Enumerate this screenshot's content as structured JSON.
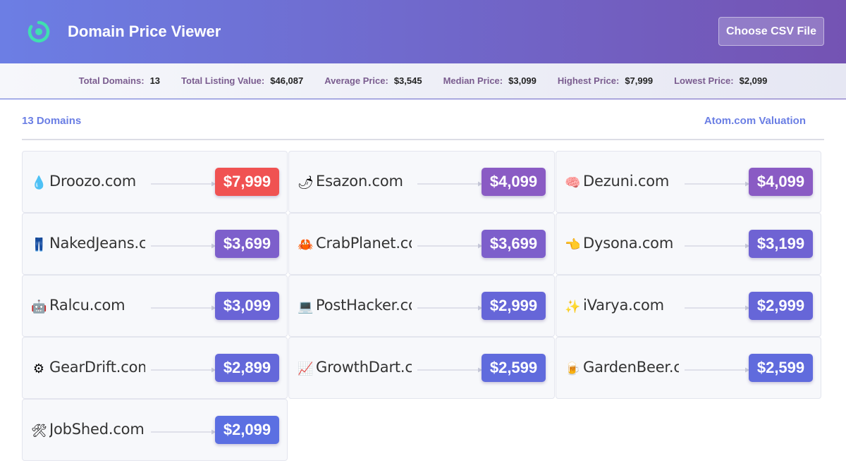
{
  "header": {
    "title": "Domain Price Viewer",
    "logo_icon": "ring-logo-icon",
    "csv_button_label": "Choose CSV File"
  },
  "stats": [
    {
      "label": "Total Domains:",
      "value": "13"
    },
    {
      "label": "Total Listing Value:",
      "value": "$46,087"
    },
    {
      "label": "Average Price:",
      "value": "$3,545"
    },
    {
      "label": "Median Price:",
      "value": "$3,099"
    },
    {
      "label": "Highest Price:",
      "value": "$7,999"
    },
    {
      "label": "Lowest Price:",
      "value": "$2,099"
    }
  ],
  "list": {
    "count_label": "13 Domains",
    "valuation_label": "Atom.com Valuation"
  },
  "domains": [
    {
      "icon": "💧",
      "icon_name": "droplet-icon",
      "name": "Droozo.com",
      "price": "$7,999",
      "color": "#f05252"
    },
    {
      "icon": "🌶",
      "icon_name": "chili-pepper-icon",
      "name": "Esazon.com",
      "price": "$4,099",
      "color": "#8a5bc4"
    },
    {
      "icon": "🧠",
      "icon_name": "brain-icon",
      "name": "Dezuni.com",
      "price": "$4,099",
      "color": "#8a5bc4"
    },
    {
      "icon": "👖",
      "icon_name": "jeans-icon",
      "name": "NakedJeans.com",
      "price": "$3,699",
      "color": "#7d5fcb"
    },
    {
      "icon": "🦀",
      "icon_name": "crab-icon",
      "name": "CrabPlanet.com",
      "price": "$3,699",
      "color": "#7d5fcb"
    },
    {
      "icon": "👈",
      "icon_name": "pointing-hand-icon",
      "name": "Dysona.com",
      "price": "$3,199",
      "color": "#6f63d3"
    },
    {
      "icon": "🤖",
      "icon_name": "robot-face-icon",
      "name": "Ralcu.com",
      "price": "$3,099",
      "color": "#6a64d6"
    },
    {
      "icon": "💻",
      "icon_name": "laptop-icon",
      "name": "PostHacker.com",
      "price": "$2,999",
      "color": "#6666d8"
    },
    {
      "icon": "✨",
      "icon_name": "sparkles-icon",
      "name": "iVarya.com",
      "price": "$2,999",
      "color": "#6666d8"
    },
    {
      "icon": "⚙",
      "icon_name": "gear-icon",
      "name": "GearDrift.com",
      "price": "$2,899",
      "color": "#6468da"
    },
    {
      "icon": "📈",
      "icon_name": "chart-up-icon",
      "name": "GrowthDart.com",
      "price": "$2,599",
      "color": "#606bdd"
    },
    {
      "icon": "🍺",
      "icon_name": "beer-mug-icon",
      "name": "GardenBeer.com",
      "price": "$2,599",
      "color": "#606bdd"
    },
    {
      "icon": "🛠",
      "icon_name": "hammer-wrench-icon",
      "name": "JobShed.com",
      "price": "$2,099",
      "color": "#5b6fe2"
    }
  ],
  "colors": {
    "accent": "#6a7ee4",
    "header_start": "#6c7ee4",
    "header_end": "#7453b3",
    "highest_price": "#f05252"
  }
}
